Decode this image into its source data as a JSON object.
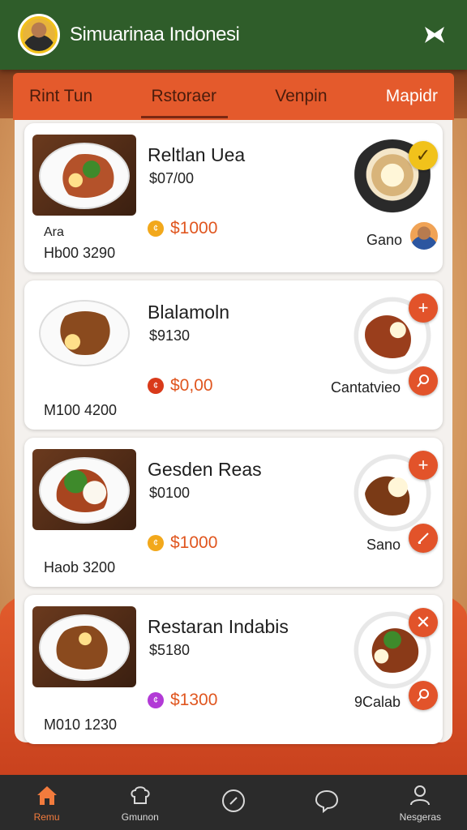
{
  "header": {
    "title": "Simuarinaa Indonesi",
    "action_icon": "close-icon"
  },
  "tabs": [
    {
      "label": "Rint Tun"
    },
    {
      "label": "Rstoraer"
    },
    {
      "label": "Venpin"
    },
    {
      "label": "Mapidr"
    }
  ],
  "cards": [
    {
      "name": "Reltlan Uea",
      "price": "$07/00",
      "promo": "$1000",
      "stat_top": "Ara",
      "stat_bottom": "Hb00 3290",
      "side_label": "Gano"
    },
    {
      "name": "Blalamoln",
      "price": "$9130",
      "promo": "$0,00",
      "stat_top": "",
      "stat_bottom": "M100 4200",
      "side_label": "Cantatvieo"
    },
    {
      "name": "Gesden Reas",
      "price": "$0100",
      "promo": "$1000",
      "stat_top": "",
      "stat_bottom": "Haob 3200",
      "side_label": "Sano"
    },
    {
      "name": "Restaran Indabis",
      "price": "$5180",
      "promo": "$1300",
      "stat_top": "",
      "stat_bottom": "M010 1230",
      "side_label": "9Calab"
    }
  ],
  "bottom_nav": [
    {
      "label": "Remu",
      "icon": "home-icon"
    },
    {
      "label": "Gmunon",
      "icon": "chef-icon"
    },
    {
      "label": "",
      "icon": "compass-icon"
    },
    {
      "label": "",
      "icon": "chat-icon"
    },
    {
      "label": "Nesgeras",
      "icon": "profile-icon"
    }
  ],
  "colors": {
    "header": "#2f5d2a",
    "accent": "#e2532a",
    "tabs": "#e45a2c",
    "nav": "#2b2b2b"
  }
}
